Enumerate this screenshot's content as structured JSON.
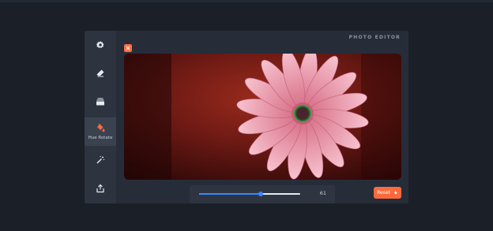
{
  "app": {
    "title": "PHOTO EDITOR"
  },
  "sidebar": {
    "items": [
      {
        "icon": "gear-icon",
        "label": ""
      },
      {
        "icon": "eraser-icon",
        "label": ""
      },
      {
        "icon": "layers-icon",
        "label": ""
      },
      {
        "icon": "paint-bucket-icon",
        "label": "Hue Rotate",
        "active": true
      },
      {
        "icon": "magic-wand-icon",
        "label": ""
      },
      {
        "icon": "share-icon",
        "label": ""
      }
    ]
  },
  "slider": {
    "value": 61,
    "min": 0,
    "max": 100,
    "display": "61"
  },
  "reset": {
    "label": "Reset"
  },
  "colors": {
    "accent": "#ff6a3d",
    "slider": "#3a86ff",
    "background": "#1a1f28",
    "panel": "#262d39",
    "sidebar": "#2d3440"
  }
}
